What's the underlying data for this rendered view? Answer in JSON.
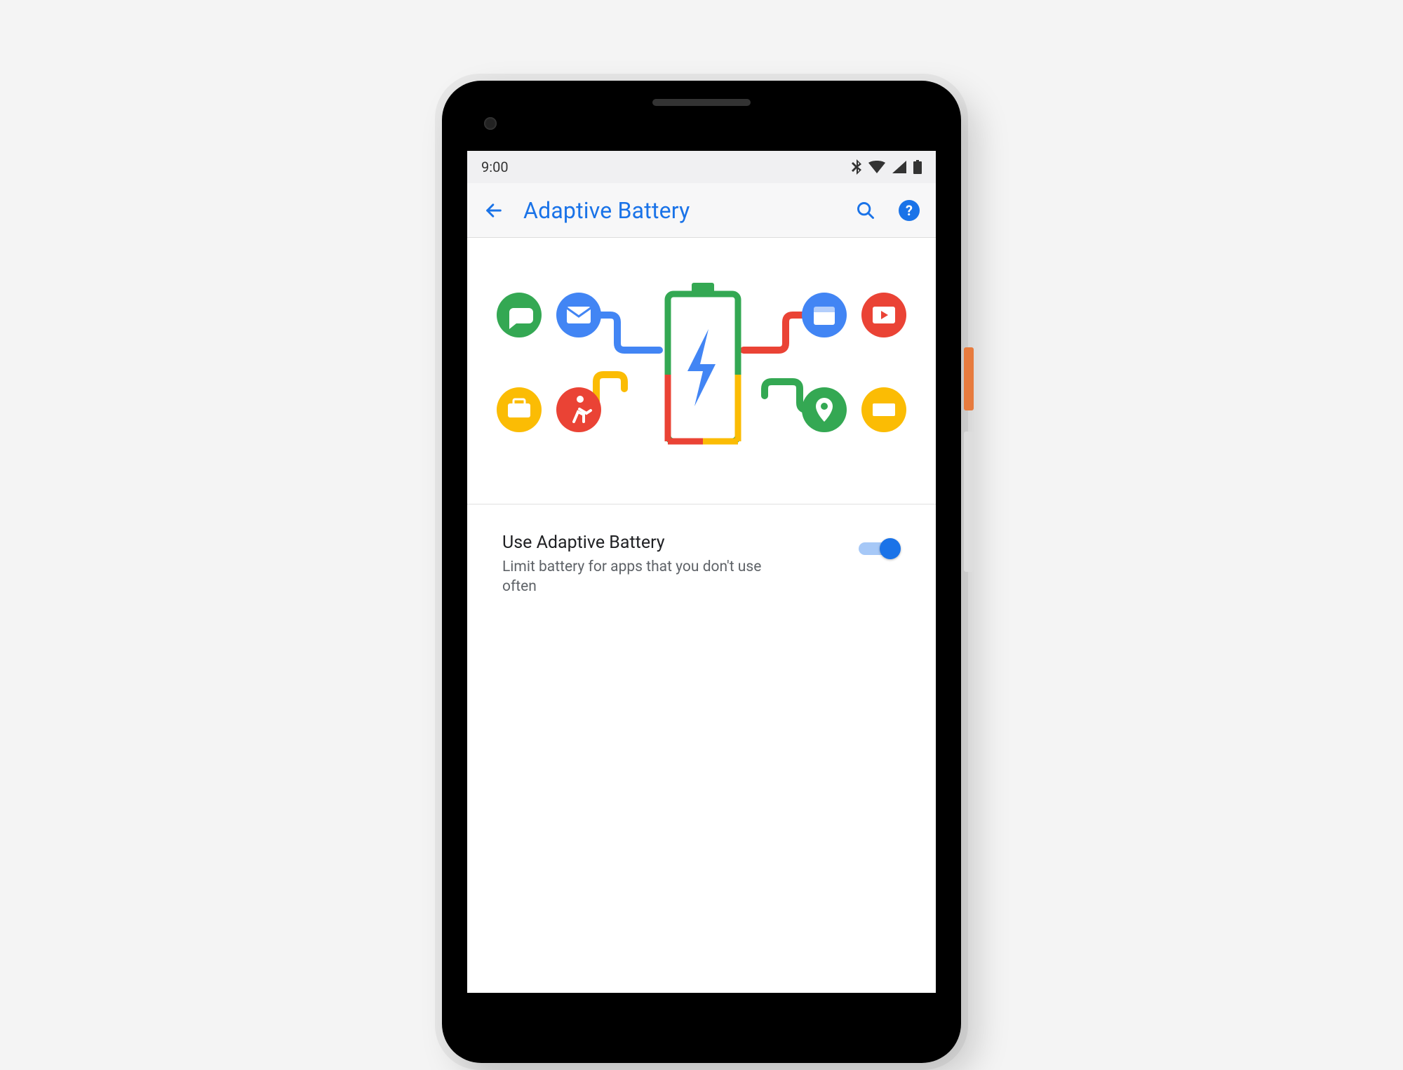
{
  "statusbar": {
    "time": "9:00"
  },
  "appbar": {
    "title": "Adaptive Battery",
    "help_label": "?"
  },
  "setting": {
    "title": "Use Adaptive Battery",
    "description": "Limit battery for apps that you don't use often",
    "enabled": true
  },
  "colors": {
    "accent": "#1a73e8",
    "google_blue": "#4285F4",
    "google_red": "#EA4335",
    "google_yellow": "#FBBC04",
    "google_green": "#34A853"
  }
}
